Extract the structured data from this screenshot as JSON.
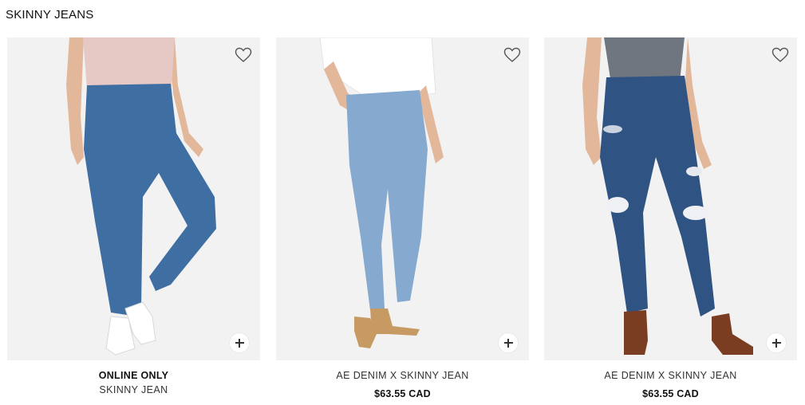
{
  "section": {
    "title": "SKINNY JEANS"
  },
  "products": [
    {
      "badge": "ONLINE ONLY",
      "name": "SKINNY JEAN",
      "price": "",
      "wash_color": "#3f6ea3",
      "top_color": "#e6c8c4",
      "shoe_color": "#ffffff"
    },
    {
      "badge": "",
      "name": "AE DENIM X SKINNY JEAN",
      "price": "$63.55 CAD",
      "wash_color": "#86a9cf",
      "top_color": "#ffffff",
      "shoe_color": "#c89a63"
    },
    {
      "badge": "",
      "name": "AE DENIM X SKINNY JEAN",
      "price": "$63.55 CAD",
      "wash_color": "#2f5382",
      "top_color": "#6f7680",
      "shoe_color": "#7a3d22"
    }
  ],
  "icons": {
    "favorite": "heart-outline-icon",
    "quick_add": "plus-icon"
  }
}
